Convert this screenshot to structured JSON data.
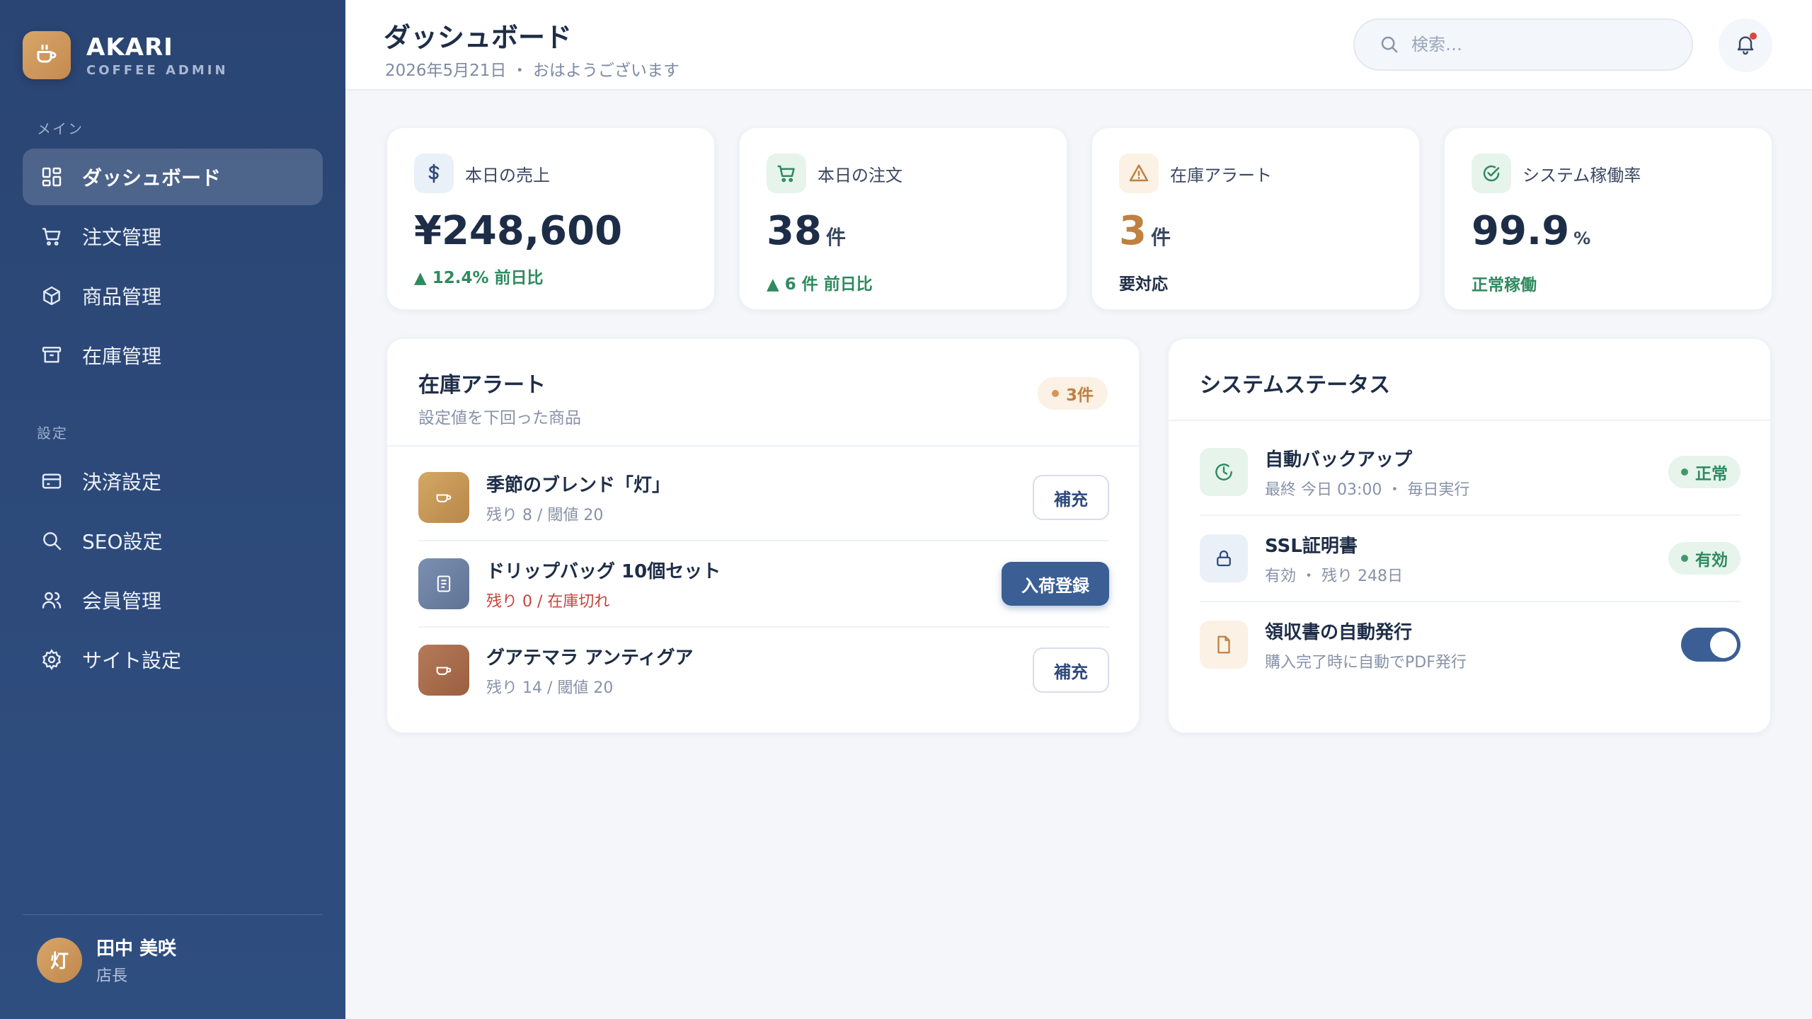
{
  "brand": {
    "name": "AKARI",
    "subtitle": "COFFEE ADMIN"
  },
  "sidebar": {
    "section_main": "メイン",
    "section_settings": "設定",
    "main_items": [
      {
        "label": "ダッシュボード",
        "icon": "grid-icon",
        "active": true
      },
      {
        "label": "注文管理",
        "icon": "cart-icon"
      },
      {
        "label": "商品管理",
        "icon": "box-icon"
      },
      {
        "label": "在庫管理",
        "icon": "archive-icon"
      }
    ],
    "settings_items": [
      {
        "label": "決済設定",
        "icon": "credit-card-icon"
      },
      {
        "label": "SEO設定",
        "icon": "search-icon"
      },
      {
        "label": "会員管理",
        "icon": "users-icon"
      },
      {
        "label": "サイト設定",
        "icon": "gear-icon"
      }
    ]
  },
  "user": {
    "initial": "灯",
    "name": "田中 美咲",
    "role": "店長"
  },
  "header": {
    "title": "ダッシュボード",
    "subtitle": "2026年5月21日 ・ おはようございます",
    "search_placeholder": "検索…"
  },
  "stats": [
    {
      "label": "本日の売上",
      "value": "¥248,600",
      "unit": "",
      "foot": "▲ 12.4% 前日比",
      "icon": "dollar-icon"
    },
    {
      "label": "本日の注文",
      "value": "38",
      "unit": "件",
      "foot": "▲ 6 件 前日比",
      "icon": "cart-icon"
    },
    {
      "label": "在庫アラート",
      "value": "3",
      "unit": "件",
      "foot": "要対応",
      "icon": "warning-icon"
    },
    {
      "label": "システム稼働率",
      "value": "99.9",
      "unit": "%",
      "foot": "正常稼働",
      "icon": "check-circle-icon"
    }
  ],
  "inventory": {
    "title": "在庫アラート",
    "subtitle": "設定値を下回った商品",
    "count_badge": "3件",
    "items": [
      {
        "name": "季節のブレンド「灯」",
        "meta": "残り 8 / 閾値 20",
        "action": "補充"
      },
      {
        "name": "ドリップバッグ 10個セット",
        "meta": "残り 0 / 在庫切れ",
        "action": "入荷登録"
      },
      {
        "name": "グアテマラ アンティグア",
        "meta": "残り 14 / 閾値 20",
        "action": "補充"
      }
    ]
  },
  "system": {
    "title": "システムステータス",
    "items": [
      {
        "name": "自動バックアップ",
        "meta": "最終 今日 03:00 ・ 毎日実行",
        "status": "正常",
        "icon": "clock-icon"
      },
      {
        "name": "SSL証明書",
        "meta": "有効 ・ 残り 248日",
        "status": "有効",
        "icon": "lock-icon"
      },
      {
        "name": "領収書の自動発行",
        "meta": "購入完了時に自動でPDF発行",
        "toggle_on": true,
        "icon": "document-icon"
      }
    ]
  },
  "colors": {
    "sidebar": "#2a4573",
    "accent": "#3b5f94",
    "brand": "#d8a66a",
    "success": "#2f8a5f",
    "danger": "#c2453a"
  }
}
